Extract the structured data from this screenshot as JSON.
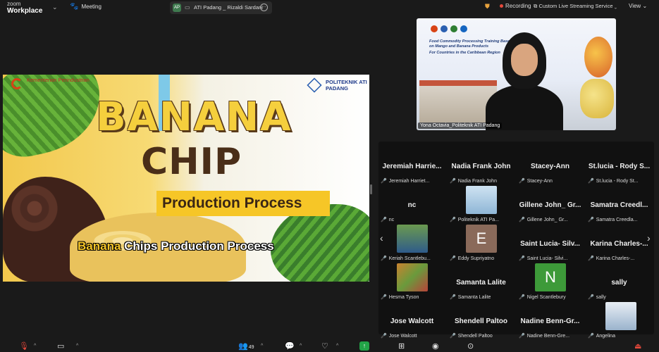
{
  "app": {
    "brand_small": "zoom",
    "brand_big": "Workplace"
  },
  "topbar": {
    "meeting_label": "Meeting",
    "share_avatar": "AP",
    "share_name": "ATI Padang _ Rizaldi Sardani",
    "recording_label": "Recording",
    "streaming_label": "Custom Live Streaming Service",
    "view_label": "View",
    "colors": {
      "recording": "#e5483b",
      "shield": "#e8a33d"
    }
  },
  "slide": {
    "logo_left": "Kementerian Perindustrian",
    "logo_right": "POLITEKNIK ATI PADANG",
    "title_1": "BANANA",
    "title_2": "CHIP",
    "subtitle": "Production Process",
    "caption_highlight": "Banana",
    "caption_rest": " Chips Production Process"
  },
  "speaker": {
    "banner_title": "Food Commodity Processing Training Based on Mango and Banana Products",
    "banner_sub": "For Countries in the Caribbean Region",
    "name": "Yona Octavia_Politeknik ATI Padang"
  },
  "gallery": {
    "tiles": [
      {
        "name": "Jeremiah  Harrie...",
        "label": "Jeremiah Harriet..."
      },
      {
        "name": "Nadia Frank John",
        "label": "Nadia Frank John"
      },
      {
        "name": "Stacey-Ann",
        "label": "Stacey-Ann"
      },
      {
        "name": "St.lucia - Rody S...",
        "label": "St.lucia - Rody St..."
      },
      {
        "name": "nc",
        "label": "nc"
      },
      {
        "name": "",
        "label": "Politeknik ATI Pa..."
      },
      {
        "name": "Gillene John_ Gr...",
        "label": "Gillene John_ Gr..."
      },
      {
        "name": "Samatra  Creedl...",
        "label": "Samatra Creedla..."
      },
      {
        "name": "",
        "label": "Keriah Scantlebu..."
      },
      {
        "name": "",
        "label": "Eddy Supriyatno",
        "letter": "E"
      },
      {
        "name": "Saint Lucia- Silv...",
        "label": "Saint Lucia- Silvi..."
      },
      {
        "name": "Karina  Charles-...",
        "label": "Karina Charles-..."
      },
      {
        "name": "",
        "label": "Hesma Tyson"
      },
      {
        "name": "Samanta Lalite",
        "label": "Samanta Lalite"
      },
      {
        "name": "",
        "label": "Nigel Scantlebury",
        "letter": "N"
      },
      {
        "name": "sally",
        "label": "sally"
      },
      {
        "name": "Jose Walcott",
        "label": "Jose Walcott"
      },
      {
        "name": "Shendell Paltoo",
        "label": "Shendell Paltoo"
      },
      {
        "name": "Nadine  Benn-Gr...",
        "label": "Nadine Benn-Gre..."
      },
      {
        "name": "",
        "label": "Angelina"
      }
    ]
  },
  "toolbar": {
    "participants_count": "49"
  }
}
